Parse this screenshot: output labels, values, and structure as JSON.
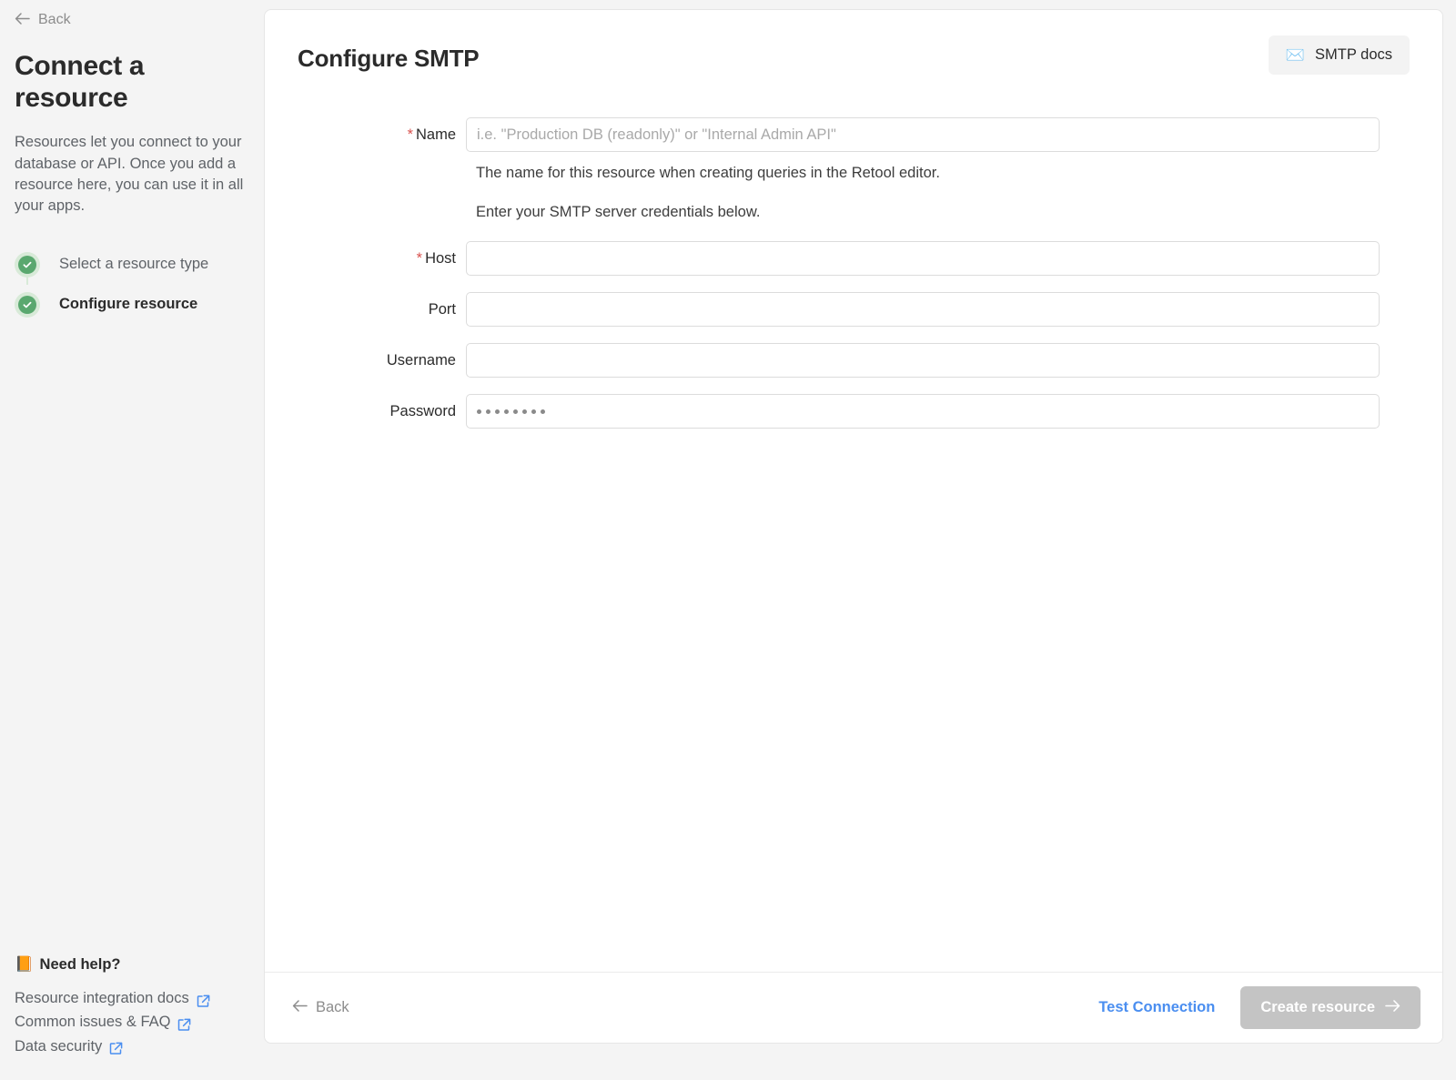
{
  "sidebar": {
    "back_label": "Back",
    "title": "Connect a resource",
    "description": "Resources let you connect to your database or API. Once you add a resource here, you can use it in all your apps.",
    "steps": [
      {
        "label": "Select a resource type",
        "state": "complete",
        "icon": "check-circle-icon"
      },
      {
        "label": "Configure resource",
        "state": "active",
        "icon": "check-circle-icon"
      }
    ],
    "help": {
      "emoji": "📙",
      "title": "Need help?",
      "links": [
        {
          "label": "Resource integration docs",
          "icon": "external-link-icon"
        },
        {
          "label": "Common issues & FAQ",
          "icon": "external-link-icon"
        },
        {
          "label": "Data security",
          "icon": "external-link-icon"
        }
      ]
    }
  },
  "main": {
    "title": "Configure SMTP",
    "docs_button": {
      "label": "SMTP docs",
      "emoji": "✉️",
      "icon": "envelope-icon"
    },
    "form": {
      "name": {
        "label": "Name",
        "required": true,
        "required_mark": "*",
        "value": "",
        "placeholder": "i.e. \"Production DB (readonly)\" or \"Internal Admin API\"",
        "helper": "The name for this resource when creating queries in the Retool editor."
      },
      "section_note": "Enter your SMTP server credentials below.",
      "host": {
        "label": "Host",
        "required": true,
        "required_mark": "*",
        "value": "",
        "placeholder": ""
      },
      "port": {
        "label": "Port",
        "required": false,
        "value": "",
        "placeholder": ""
      },
      "username": {
        "label": "Username",
        "required": false,
        "value": "",
        "placeholder": ""
      },
      "password": {
        "label": "Password",
        "required": false,
        "masked_value": "••••••••",
        "dot_count": 8
      }
    },
    "footer": {
      "back_label": "Back",
      "test_label": "Test Connection",
      "create_label": "Create resource",
      "create_disabled": true
    }
  },
  "colors": {
    "background": "#f4f4f4",
    "panel": "#ffffff",
    "accent_blue": "#4a8ef0",
    "step_green": "#5aa86f",
    "step_green_ring": "#d8ead8",
    "required_red": "#d9534f",
    "disabled_button": "#c4c4c4",
    "text_primary": "#2b2b2b",
    "text_muted": "#5f6368"
  }
}
